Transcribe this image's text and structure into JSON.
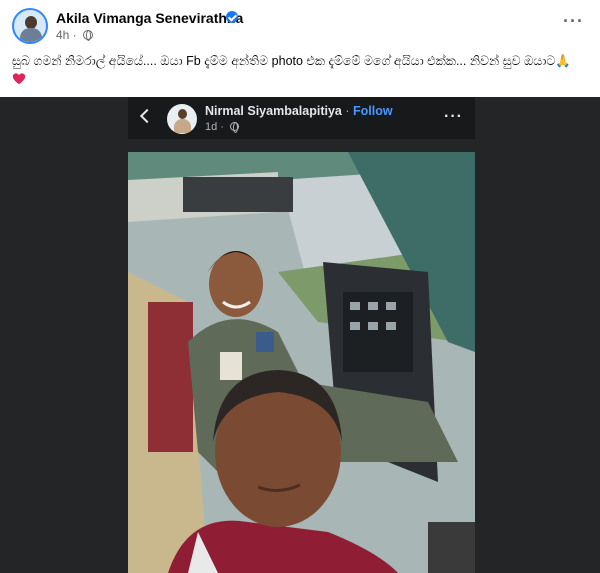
{
  "post": {
    "author": "Akila Vimanga Senevirathna",
    "time": "4h ·",
    "text": "සුබ ගමන් නිමරාල් අයියේ.... ඔයා Fb දැම්ම අන්තිම photo එක දැම්මේ මගේ අයියා එක්ක... නිවන් සුව ඔයාට🙏"
  },
  "shared": {
    "author": "Nirmal Siyambalapitiya",
    "separator": "·",
    "follow": "Follow",
    "time": "1d ·"
  },
  "icons": {
    "avatar": "profile-photo",
    "verified": "verified-badge-icon",
    "globe": "globe-icon",
    "more": "more-options-icon",
    "heart": "red-heart-emoji",
    "back": "back-arrow-icon"
  },
  "colors": {
    "accent": "#1877f2",
    "follow": "#4599ff",
    "dark_bg": "#242526",
    "heart": "#e0245e"
  }
}
